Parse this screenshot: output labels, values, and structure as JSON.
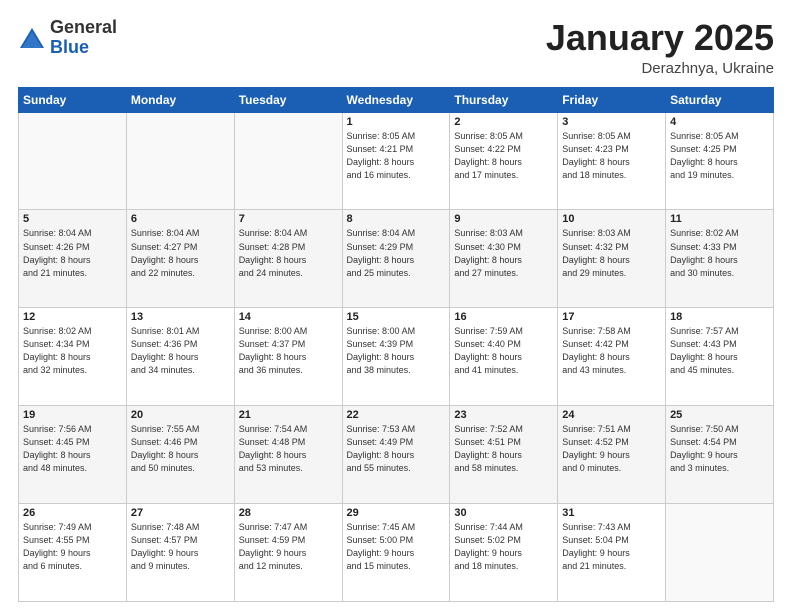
{
  "header": {
    "logo_general": "General",
    "logo_blue": "Blue",
    "month_title": "January 2025",
    "subtitle": "Derazhnya, Ukraine"
  },
  "days_of_week": [
    "Sunday",
    "Monday",
    "Tuesday",
    "Wednesday",
    "Thursday",
    "Friday",
    "Saturday"
  ],
  "weeks": [
    [
      {
        "day": "",
        "info": ""
      },
      {
        "day": "",
        "info": ""
      },
      {
        "day": "",
        "info": ""
      },
      {
        "day": "1",
        "info": "Sunrise: 8:05 AM\nSunset: 4:21 PM\nDaylight: 8 hours\nand 16 minutes."
      },
      {
        "day": "2",
        "info": "Sunrise: 8:05 AM\nSunset: 4:22 PM\nDaylight: 8 hours\nand 17 minutes."
      },
      {
        "day": "3",
        "info": "Sunrise: 8:05 AM\nSunset: 4:23 PM\nDaylight: 8 hours\nand 18 minutes."
      },
      {
        "day": "4",
        "info": "Sunrise: 8:05 AM\nSunset: 4:25 PM\nDaylight: 8 hours\nand 19 minutes."
      }
    ],
    [
      {
        "day": "5",
        "info": "Sunrise: 8:04 AM\nSunset: 4:26 PM\nDaylight: 8 hours\nand 21 minutes."
      },
      {
        "day": "6",
        "info": "Sunrise: 8:04 AM\nSunset: 4:27 PM\nDaylight: 8 hours\nand 22 minutes."
      },
      {
        "day": "7",
        "info": "Sunrise: 8:04 AM\nSunset: 4:28 PM\nDaylight: 8 hours\nand 24 minutes."
      },
      {
        "day": "8",
        "info": "Sunrise: 8:04 AM\nSunset: 4:29 PM\nDaylight: 8 hours\nand 25 minutes."
      },
      {
        "day": "9",
        "info": "Sunrise: 8:03 AM\nSunset: 4:30 PM\nDaylight: 8 hours\nand 27 minutes."
      },
      {
        "day": "10",
        "info": "Sunrise: 8:03 AM\nSunset: 4:32 PM\nDaylight: 8 hours\nand 29 minutes."
      },
      {
        "day": "11",
        "info": "Sunrise: 8:02 AM\nSunset: 4:33 PM\nDaylight: 8 hours\nand 30 minutes."
      }
    ],
    [
      {
        "day": "12",
        "info": "Sunrise: 8:02 AM\nSunset: 4:34 PM\nDaylight: 8 hours\nand 32 minutes."
      },
      {
        "day": "13",
        "info": "Sunrise: 8:01 AM\nSunset: 4:36 PM\nDaylight: 8 hours\nand 34 minutes."
      },
      {
        "day": "14",
        "info": "Sunrise: 8:00 AM\nSunset: 4:37 PM\nDaylight: 8 hours\nand 36 minutes."
      },
      {
        "day": "15",
        "info": "Sunrise: 8:00 AM\nSunset: 4:39 PM\nDaylight: 8 hours\nand 38 minutes."
      },
      {
        "day": "16",
        "info": "Sunrise: 7:59 AM\nSunset: 4:40 PM\nDaylight: 8 hours\nand 41 minutes."
      },
      {
        "day": "17",
        "info": "Sunrise: 7:58 AM\nSunset: 4:42 PM\nDaylight: 8 hours\nand 43 minutes."
      },
      {
        "day": "18",
        "info": "Sunrise: 7:57 AM\nSunset: 4:43 PM\nDaylight: 8 hours\nand 45 minutes."
      }
    ],
    [
      {
        "day": "19",
        "info": "Sunrise: 7:56 AM\nSunset: 4:45 PM\nDaylight: 8 hours\nand 48 minutes."
      },
      {
        "day": "20",
        "info": "Sunrise: 7:55 AM\nSunset: 4:46 PM\nDaylight: 8 hours\nand 50 minutes."
      },
      {
        "day": "21",
        "info": "Sunrise: 7:54 AM\nSunset: 4:48 PM\nDaylight: 8 hours\nand 53 minutes."
      },
      {
        "day": "22",
        "info": "Sunrise: 7:53 AM\nSunset: 4:49 PM\nDaylight: 8 hours\nand 55 minutes."
      },
      {
        "day": "23",
        "info": "Sunrise: 7:52 AM\nSunset: 4:51 PM\nDaylight: 8 hours\nand 58 minutes."
      },
      {
        "day": "24",
        "info": "Sunrise: 7:51 AM\nSunset: 4:52 PM\nDaylight: 9 hours\nand 0 minutes."
      },
      {
        "day": "25",
        "info": "Sunrise: 7:50 AM\nSunset: 4:54 PM\nDaylight: 9 hours\nand 3 minutes."
      }
    ],
    [
      {
        "day": "26",
        "info": "Sunrise: 7:49 AM\nSunset: 4:55 PM\nDaylight: 9 hours\nand 6 minutes."
      },
      {
        "day": "27",
        "info": "Sunrise: 7:48 AM\nSunset: 4:57 PM\nDaylight: 9 hours\nand 9 minutes."
      },
      {
        "day": "28",
        "info": "Sunrise: 7:47 AM\nSunset: 4:59 PM\nDaylight: 9 hours\nand 12 minutes."
      },
      {
        "day": "29",
        "info": "Sunrise: 7:45 AM\nSunset: 5:00 PM\nDaylight: 9 hours\nand 15 minutes."
      },
      {
        "day": "30",
        "info": "Sunrise: 7:44 AM\nSunset: 5:02 PM\nDaylight: 9 hours\nand 18 minutes."
      },
      {
        "day": "31",
        "info": "Sunrise: 7:43 AM\nSunset: 5:04 PM\nDaylight: 9 hours\nand 21 minutes."
      },
      {
        "day": "",
        "info": ""
      }
    ]
  ]
}
